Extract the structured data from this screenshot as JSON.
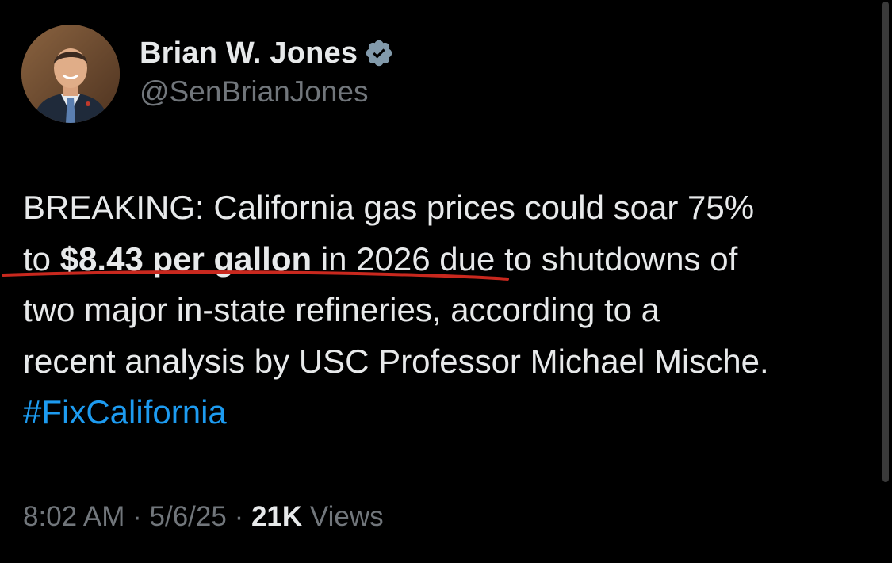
{
  "author": {
    "display_name": "Brian W. Jones",
    "handle": "@SenBrianJones",
    "verified": true,
    "verified_icon": "verified-badge-icon"
  },
  "tweet": {
    "segments": {
      "line1": "BREAKING: California gas prices could soar 75%",
      "line2_pre": "to ",
      "line2_bold": "$8.43 per gallon",
      "line2_mid": " in 2026",
      "line2_post": " due to shutdowns of",
      "line3": "two major in-state refineries, according to a",
      "line4": "recent analysis by USC Professor Michael Mische.",
      "hashtag": "#FixCalifornia"
    }
  },
  "meta": {
    "time": "8:02 AM",
    "separator": " · ",
    "date": "5/6/25",
    "views_count": "21K",
    "views_label": " Views"
  },
  "colors": {
    "background": "#000000",
    "text": "#e7e9ea",
    "secondary": "#71767b",
    "link": "#1d9bf0",
    "annotation": "#c8281e"
  }
}
